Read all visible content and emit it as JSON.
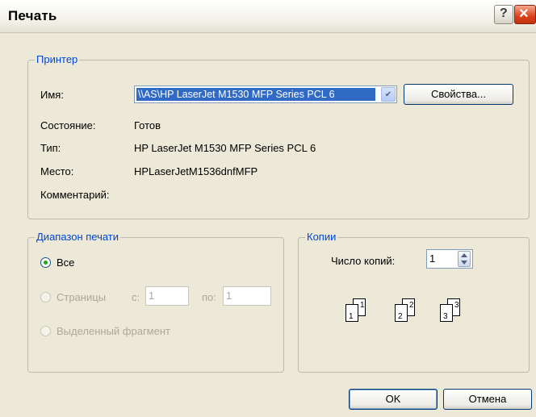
{
  "window": {
    "title": "Печать",
    "help_label": "?",
    "close_label": "×"
  },
  "printer": {
    "group_label": "Принтер",
    "name_label": "Имя:",
    "name_value": "\\\\AS\\HP LaserJet M1530 MFP Series PCL 6",
    "properties_button": "Свойства...",
    "status_label": "Состояние:",
    "status_value": "Готов",
    "type_label": "Тип:",
    "type_value": "HP LaserJet M1530 MFP Series PCL 6",
    "location_label": "Место:",
    "location_value": "HPLaserJetM1536dnfMFP",
    "comment_label": "Комментарий:",
    "comment_value": ""
  },
  "range": {
    "group_label": "Диапазон печати",
    "all_label": "Все",
    "pages_label": "Страницы",
    "from_label": "с:",
    "from_value": "1",
    "to_label": "по:",
    "to_value": "1",
    "selection_label": "Выделенный фрагмент",
    "selected": "all"
  },
  "copies": {
    "group_label": "Копии",
    "count_label": "Число копий:",
    "count_value": "1",
    "collate_pages": [
      "1",
      "1",
      "2",
      "2",
      "3",
      "3"
    ]
  },
  "buttons": {
    "ok": "OK",
    "cancel": "Отмена"
  }
}
